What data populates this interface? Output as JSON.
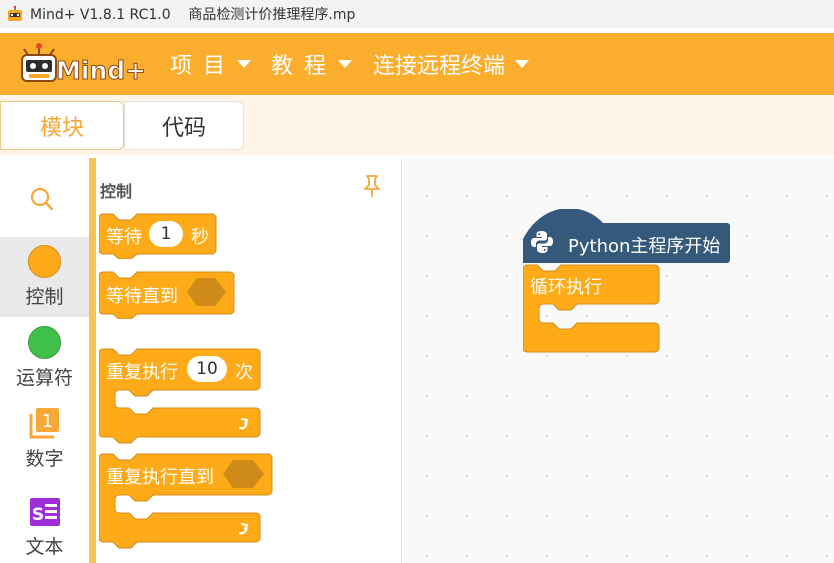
{
  "window": {
    "title": "Mind+ V1.8.1 RC1.0    商品检测计价推理程序.mp"
  },
  "menubar": {
    "logo_text": "Mind+",
    "items": [
      {
        "label": "项 目"
      },
      {
        "label": "教 程"
      },
      {
        "label": "连接远程终端"
      }
    ]
  },
  "tabs": [
    {
      "label": "模块",
      "active": true
    },
    {
      "label": "代码",
      "active": false
    }
  ],
  "categories": [
    {
      "label": "控制",
      "icon": "orange-circle-icon",
      "color": "#ffab19"
    },
    {
      "label": "运算符",
      "icon": "green-circle-icon",
      "color": "#40bf4a"
    },
    {
      "label": "数字",
      "icon": "number-one-icon",
      "color": "#f7a735"
    },
    {
      "label": "文本",
      "icon": "text-s-icon",
      "color": "#9d2ed9"
    }
  ],
  "palette": {
    "title": "控制",
    "blocks": {
      "wait": {
        "label": "等待",
        "value": "1",
        "unit": "秒"
      },
      "wait_until": {
        "label": "等待直到"
      },
      "repeat": {
        "label": "重复执行",
        "value": "10",
        "unit": "次"
      },
      "repeat_until": {
        "label": "重复执行直到"
      }
    }
  },
  "workspace": {
    "hat_block": {
      "label": "Python主程序开始"
    },
    "forever_block": {
      "label": "循环执行"
    }
  },
  "colors": {
    "accent": "#fbad2d",
    "control_block": "#ffab19",
    "control_block_dark": "#cf8b17",
    "python_hat": "#34597a",
    "number_cat": "#f7a735",
    "text_cat": "#9d2ed9"
  },
  "number_icon_text": "1",
  "text_icon_text": "S"
}
